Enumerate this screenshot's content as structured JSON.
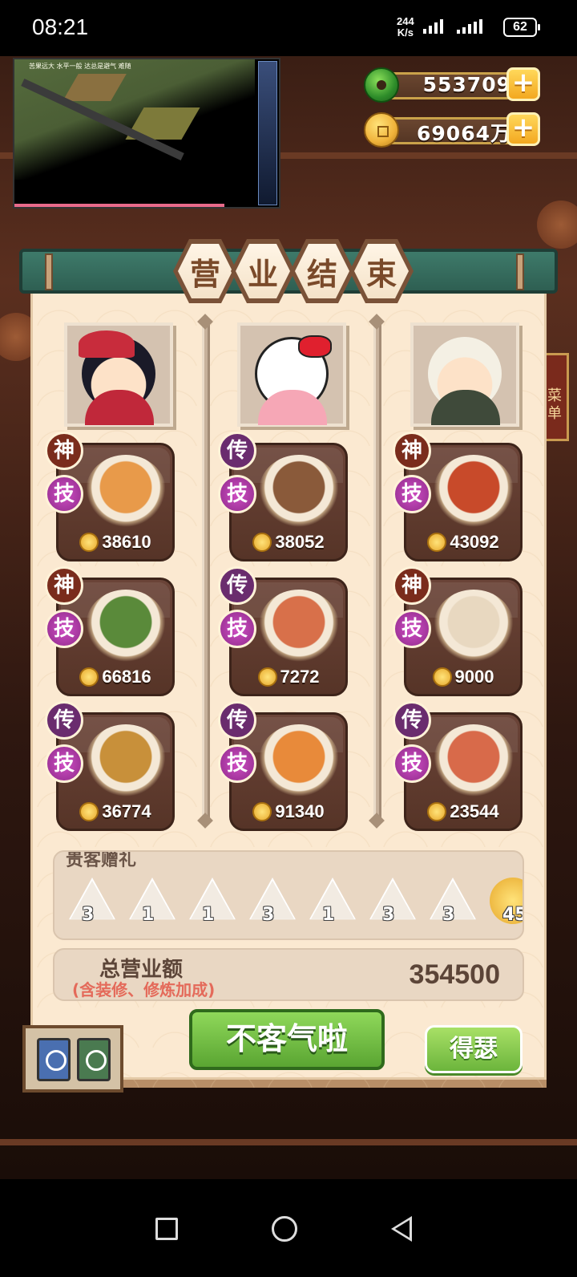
{
  "status_bar": {
    "time": "08:21",
    "net_speed_value": "244",
    "net_speed_unit": "K/s",
    "battery": "62"
  },
  "mini_view": {
    "caption": "苦果远大 水平一般 达总是避气 难随"
  },
  "currency": {
    "jade": "553709",
    "coins": "69064万"
  },
  "title_chars": [
    "营",
    "业",
    "结",
    "束"
  ],
  "columns": [
    {
      "avatar": "boy-chef",
      "dishes": [
        {
          "rank": "神",
          "skill": "技",
          "price": "38610",
          "color": "#e89a4a"
        },
        {
          "rank": "神",
          "skill": "技",
          "price": "66816",
          "color": "#5a8a3a"
        },
        {
          "rank": "传",
          "skill": "技",
          "price": "36774",
          "color": "#c8903a"
        }
      ]
    },
    {
      "avatar": "hello-kitty",
      "dishes": [
        {
          "rank": "传",
          "skill": "技",
          "price": "38052",
          "color": "#8a5a3a"
        },
        {
          "rank": "传",
          "skill": "技",
          "price": "7272",
          "color": "#d8704a"
        },
        {
          "rank": "传",
          "skill": "技",
          "price": "91340",
          "color": "#e88a3a"
        }
      ]
    },
    {
      "avatar": "sheep-girl",
      "dishes": [
        {
          "rank": "神",
          "skill": "技",
          "price": "43092",
          "color": "#c84a2a"
        },
        {
          "rank": "神",
          "skill": "技",
          "price": "9000",
          "color": "#e8d8c0"
        },
        {
          "rank": "传",
          "skill": "技",
          "price": "23544",
          "color": "#d86a4a"
        }
      ]
    }
  ],
  "gifts": {
    "title": "贵客赠礼",
    "items": [
      "3",
      "1",
      "1",
      "3",
      "1",
      "3",
      "3",
      "45"
    ]
  },
  "total": {
    "label": "总营业额",
    "sub": "(含装修、修炼加成)",
    "value": "354500"
  },
  "buttons": {
    "main": "不客气啦",
    "secondary": "得瑟"
  },
  "side_tab": "菜单"
}
